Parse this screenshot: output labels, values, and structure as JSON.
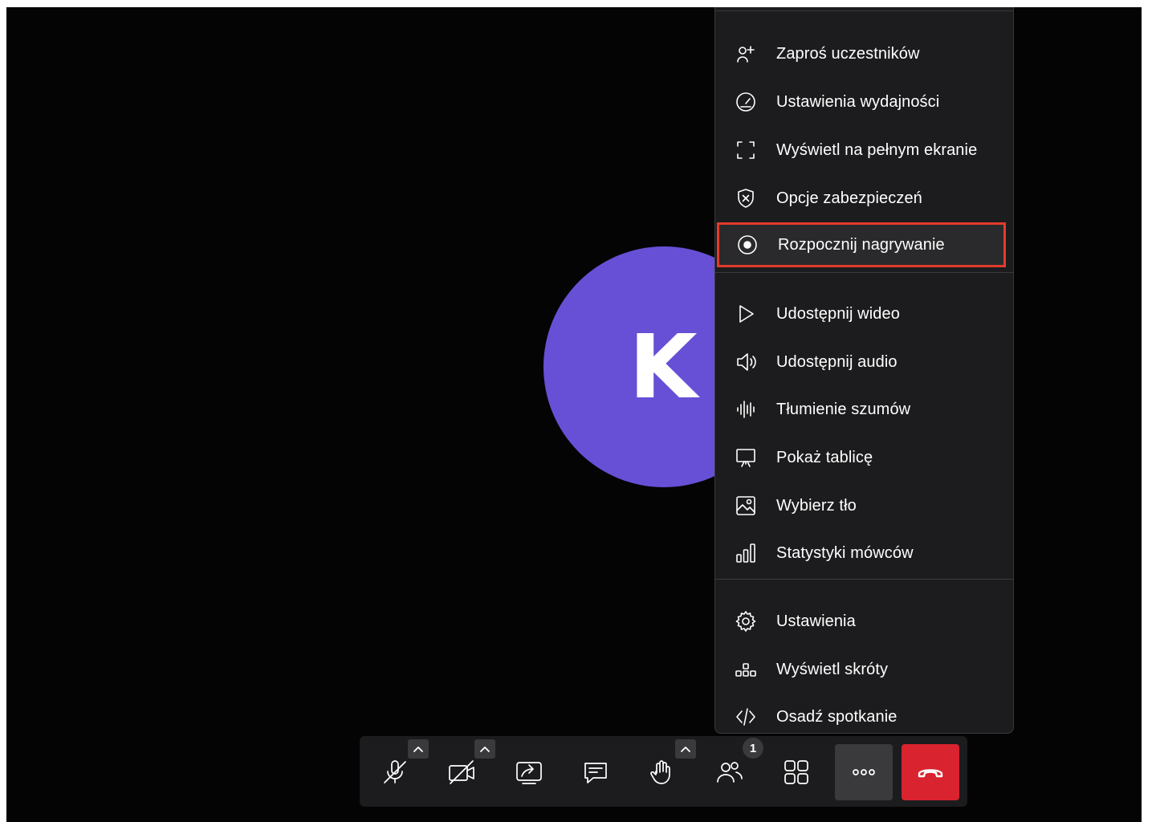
{
  "participant": {
    "initial": "K",
    "avatar_color": "#6750d6"
  },
  "menu": {
    "sections": [
      [
        {
          "label": "Zaproś uczestników",
          "icon": "add-user-icon"
        },
        {
          "label": "Ustawienia wydajności",
          "icon": "speedometer-icon"
        },
        {
          "label": "Wyświetl na pełnym ekranie",
          "icon": "fullscreen-icon"
        },
        {
          "label": "Opcje zabezpieczeń",
          "icon": "shield-icon"
        },
        {
          "label": "Rozpocznij nagrywanie",
          "icon": "record-icon",
          "highlighted": true
        }
      ],
      [
        {
          "label": "Udostępnij wideo",
          "icon": "play-icon"
        },
        {
          "label": "Udostępnij audio",
          "icon": "speaker-icon"
        },
        {
          "label": "Tłumienie szumów",
          "icon": "waveform-icon"
        },
        {
          "label": "Pokaż tablicę",
          "icon": "whiteboard-icon"
        },
        {
          "label": "Wybierz tło",
          "icon": "image-icon"
        },
        {
          "label": "Statystyki mówców",
          "icon": "bar-chart-icon"
        }
      ],
      [
        {
          "label": "Ustawienia",
          "icon": "gear-icon"
        },
        {
          "label": "Wyświetl skróty",
          "icon": "shortcuts-icon"
        },
        {
          "label": "Osadź spotkanie",
          "icon": "code-icon"
        }
      ]
    ],
    "highlight_color": "#e23b2b"
  },
  "toolbar": {
    "buttons": [
      {
        "name": "microphone-muted",
        "icon": "microphone-off-icon",
        "has_caret": true
      },
      {
        "name": "camera-off",
        "icon": "camera-off-icon",
        "has_caret": true
      },
      {
        "name": "share-screen",
        "icon": "share-screen-icon"
      },
      {
        "name": "chat",
        "icon": "chat-icon"
      },
      {
        "name": "raise-hand",
        "icon": "hand-icon",
        "has_caret": true
      },
      {
        "name": "participants",
        "icon": "participants-icon",
        "badge": "1"
      },
      {
        "name": "tile-view",
        "icon": "grid-icon"
      },
      {
        "name": "more-actions",
        "icon": "more-icon",
        "active": true
      },
      {
        "name": "leave-meeting",
        "icon": "hangup-icon",
        "color": "#d9232f"
      }
    ]
  }
}
